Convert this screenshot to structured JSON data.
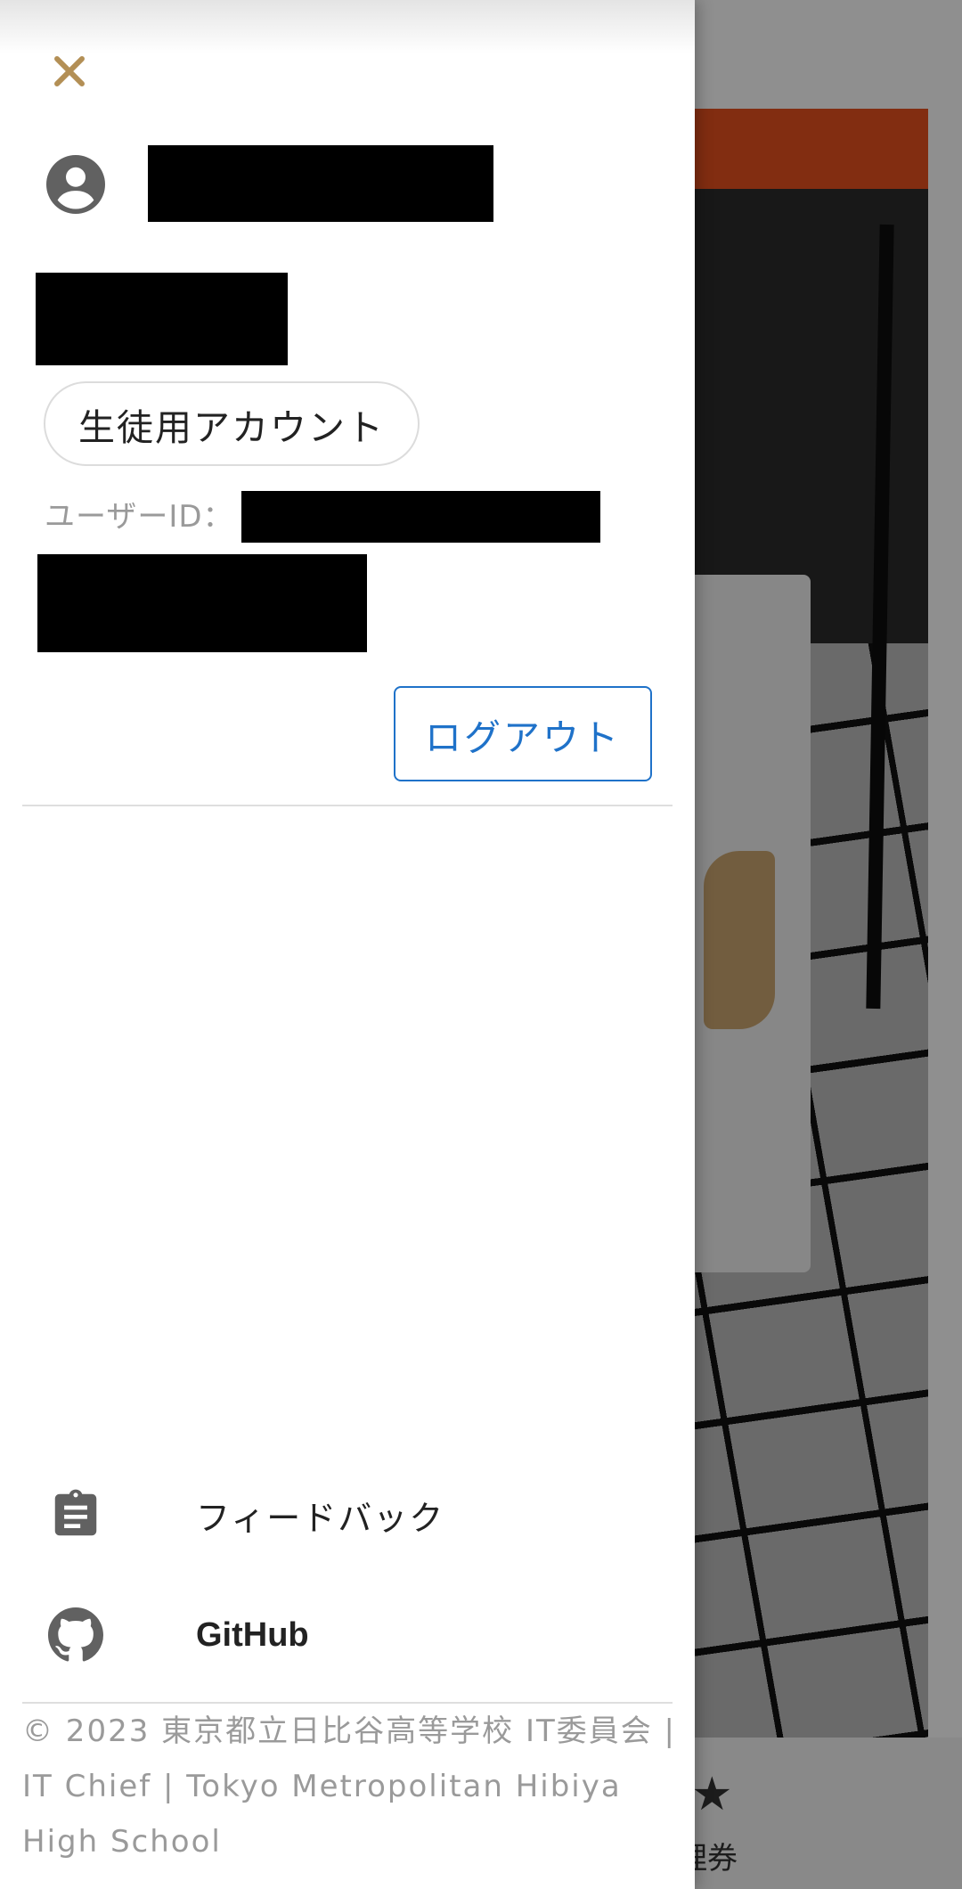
{
  "drawer": {
    "close_icon": "close-icon",
    "avatar_icon": "account-circle-icon",
    "account_type_label": "生徒用アカウント",
    "user_id_label": "ユーザーID：",
    "logout_label": "ログアウト",
    "menu": [
      {
        "label": "フィードバック",
        "icon": "clipboard-icon"
      },
      {
        "label": "GitHub",
        "icon": "github-icon"
      }
    ],
    "footer_text": "© 2023 東京都立日比谷高等学校 IT委員会 | IT Chief | Tokyo Metropolitan Hibiya High School"
  },
  "background": {
    "nav_label_partial": "理券",
    "nav_icon": "star-ticket-icon"
  },
  "colors": {
    "close_icon": "#b38f55",
    "logout_accent": "#1f72c9",
    "icon_gray": "#616161"
  }
}
